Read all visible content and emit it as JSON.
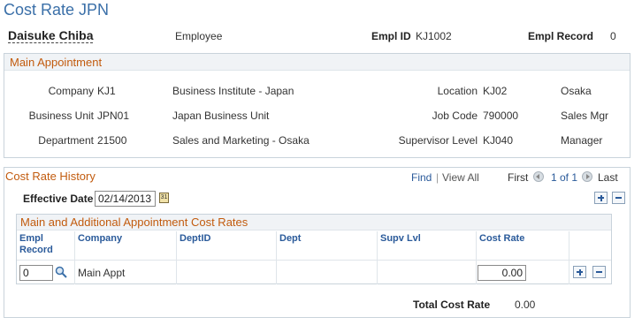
{
  "page": {
    "title": "Cost Rate JPN"
  },
  "header": {
    "name": "Daisuke Chiba",
    "employee_label": "Employee",
    "empl_id_label": "Empl ID",
    "empl_id_value": "KJ1002",
    "empl_record_label": "Empl Record",
    "empl_record_value": "0"
  },
  "main_appointment": {
    "title": "Main Appointment",
    "fields": {
      "company_label": "Company",
      "company_code": "KJ1",
      "company_desc": "Business Institute - Japan",
      "business_unit_label": "Business Unit",
      "business_unit_code": "JPN01",
      "business_unit_desc": "Japan Business Unit",
      "department_label": "Department",
      "department_code": "21500",
      "department_desc": "Sales and Marketing - Osaka",
      "location_label": "Location",
      "location_code": "KJ02",
      "location_desc": "Osaka",
      "job_code_label": "Job Code",
      "job_code_code": "790000",
      "job_code_desc": "Sales Mgr",
      "supervisor_level_label": "Supervisor Level",
      "supervisor_level_code": "KJ040",
      "supervisor_level_desc": "Manager"
    }
  },
  "cost_rate_history": {
    "title": "Cost Rate History",
    "find_label": "Find",
    "separator": "|",
    "view_all_label": "View All",
    "first_label": "First",
    "page_indicator": "1 of 1",
    "last_label": "Last",
    "effective_date_label": "Effective Date",
    "effective_date_value": "02/14/2013",
    "calendar_glyph": "31"
  },
  "rates_grid": {
    "title": "Main and Additional Appointment Cost Rates",
    "columns": {
      "empl_record": "Empl Record",
      "company": "Company",
      "deptid": "DeptID",
      "dept": "Dept",
      "supv_lvl": "Supv Lvl",
      "cost_rate": "Cost Rate"
    },
    "rows": [
      {
        "empl_record": "0",
        "company": "Main Appt",
        "deptid": "",
        "dept": "",
        "supv_lvl": "",
        "cost_rate": "0.00"
      }
    ]
  },
  "totals": {
    "total_cost_rate_label": "Total Cost Rate",
    "total_cost_rate_value": "0.00"
  },
  "icons": {
    "calendar": "calendar-icon",
    "lookup": "magnifier-icon",
    "add": "plus-icon",
    "remove": "minus-icon",
    "prev": "chevron-left-icon",
    "next": "chevron-right-icon"
  },
  "colors": {
    "title_blue": "#3a6fa8",
    "section_orange": "#c25b0e",
    "link_blue": "#2a5a9a"
  }
}
